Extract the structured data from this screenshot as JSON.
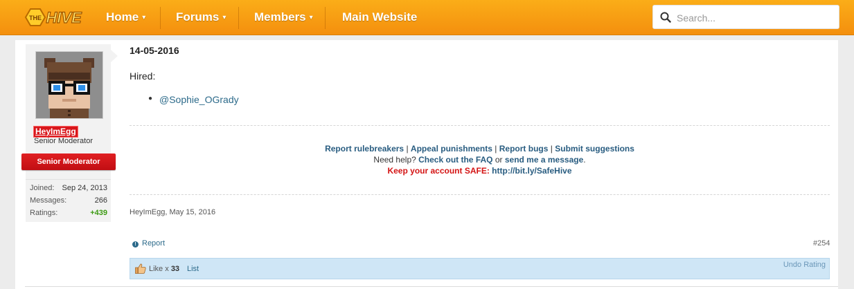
{
  "nav": {
    "logo_text": "THE HIVE",
    "items": [
      {
        "label": "Home",
        "caret": "▾"
      },
      {
        "label": "Forums",
        "caret": "▾"
      },
      {
        "label": "Members",
        "caret": "▾"
      },
      {
        "label": "Main Website",
        "caret": ""
      }
    ],
    "search_placeholder": "Search..."
  },
  "user": {
    "name": "HeyImEgg",
    "title": "Senior Moderator",
    "rank_banner": "Senior Moderator",
    "stats": [
      {
        "label": "Joined:",
        "value": "Sep 24, 2013"
      },
      {
        "label": "Messages:",
        "value": "266"
      },
      {
        "label": "Ratings:",
        "value": "+439"
      }
    ]
  },
  "post": {
    "date_heading": "14-05-2016",
    "hired_label": "Hired:",
    "hired_list": [
      "@Sophie_OGrady"
    ],
    "signature": {
      "line1": [
        "Report rulebreakers",
        "Appeal punishments",
        "Report bugs",
        "Submit suggestions"
      ],
      "line1_sep": "|",
      "line2_prefix": "Need help?",
      "line2_faq": "Check out the FAQ",
      "line2_or": "or",
      "line2_msg": "send me a message",
      "line2_end": ".",
      "line3_label": "Keep your account SAFE:",
      "line3_link": "http://bit.ly/SafeHive"
    },
    "author_line": "HeyImEgg, May 15, 2016",
    "report_label": "Report",
    "post_number": "#254",
    "likes": {
      "prefix": "Like x",
      "count": "33",
      "list_label": "List",
      "undo_label": "Undo Rating"
    }
  },
  "colors": {
    "nav_orange": "#f7a013",
    "mod_red": "#d8161b",
    "link_blue": "#285c80",
    "like_bar": "#cfe6f6",
    "ratings_green": "#3c9a12"
  }
}
